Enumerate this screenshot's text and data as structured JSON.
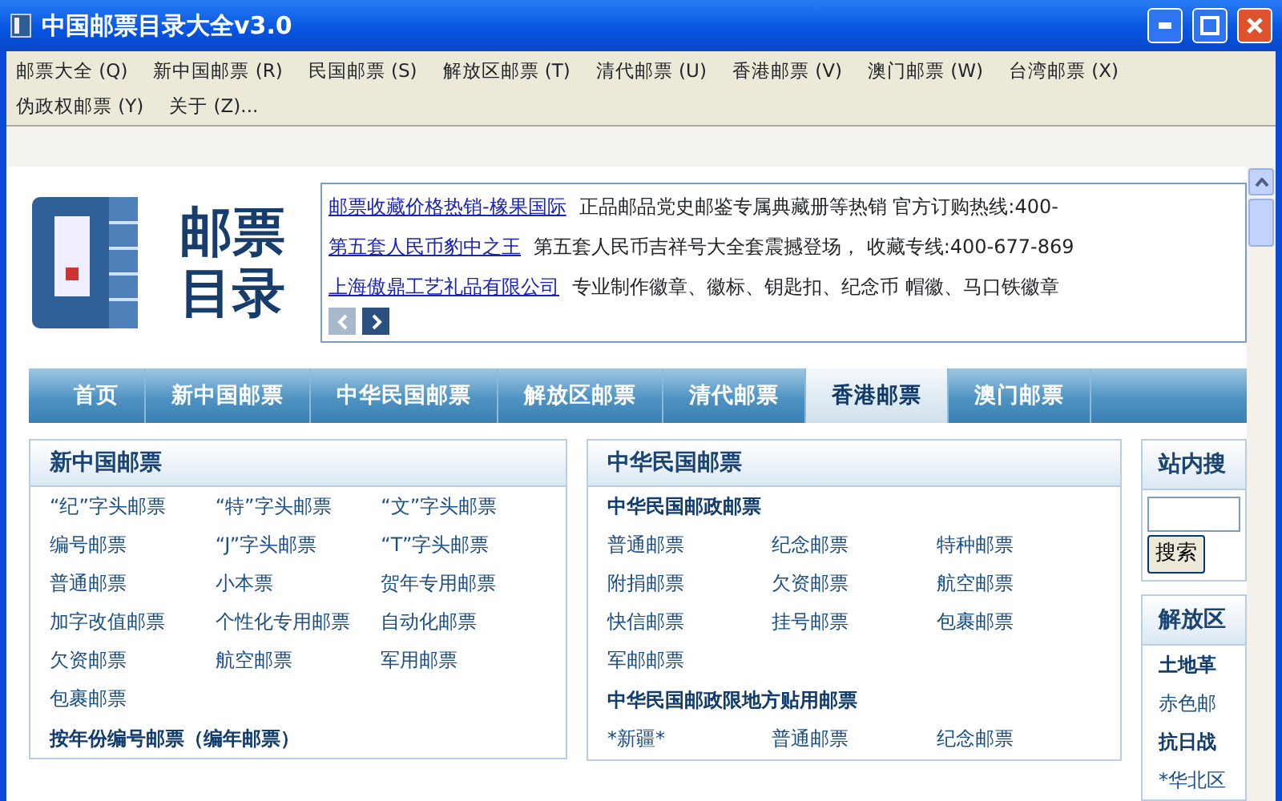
{
  "window": {
    "title": "中国邮票目录大全v3.0"
  },
  "menu": [
    "邮票大全 (Q)",
    "新中国邮票 (R)",
    "民国邮票 (S)",
    "解放区邮票 (T)",
    "清代邮票 (U)",
    "香港邮票 (V)",
    "澳门邮票 (W)",
    "台湾邮票 (X)",
    "伪政权邮票 (Y)",
    "关于 (Z)..."
  ],
  "logo": {
    "line_1": "邮票",
    "line_2": "目录"
  },
  "ads": [
    {
      "link": "邮票收藏价格热销-橡果国际",
      "text": "正品邮品党史邮鉴专属典藏册等热销  官方订购热线:400-"
    },
    {
      "link": "第五套人民币豹中之王",
      "text": "第五套人民币吉祥号大全套震撼登场，  收藏专线:400-677-869"
    },
    {
      "link": "上海傲鼎工艺礼品有限公司",
      "text": "专业制作徽章、徽标、钥匙扣、纪念币 帽徽、马口铁徽章"
    }
  ],
  "ad_pager": {
    "prev_disabled": true
  },
  "nav": [
    {
      "label": "首页",
      "selected": false
    },
    {
      "label": "新中国邮票",
      "selected": false
    },
    {
      "label": "中华民国邮票",
      "selected": false
    },
    {
      "label": "解放区邮票",
      "selected": false
    },
    {
      "label": "清代邮票",
      "selected": false
    },
    {
      "label": "香港邮票",
      "selected": true
    },
    {
      "label": "澳门邮票",
      "selected": false
    }
  ],
  "panel_new_china": {
    "title": "新中国邮票",
    "links": [
      "“纪”字头邮票",
      "“特”字头邮票",
      "“文”字头邮票",
      "编号邮票",
      "“J”字头邮票",
      "“T”字头邮票",
      "普通邮票",
      "小本票",
      "贺年专用邮票",
      "加字改值邮票",
      "个性化专用邮票",
      "自动化邮票",
      "欠资邮票",
      "航空邮票",
      "军用邮票",
      "包裹邮票"
    ],
    "subheading": "按年份编号邮票（编年邮票）"
  },
  "panel_roc": {
    "title": "中华民国邮票",
    "sections": [
      {
        "heading": "中华民国邮政邮票",
        "links": [
          "普通邮票",
          "纪念邮票",
          "特种邮票",
          "附捐邮票",
          "欠资邮票",
          "航空邮票",
          "快信邮票",
          "挂号邮票",
          "包裹邮票",
          "军邮邮票"
        ]
      },
      {
        "heading": "中华民国邮政限地方贴用邮票",
        "links": [
          "*新疆*",
          "普通邮票",
          "纪念邮票"
        ]
      }
    ]
  },
  "search_panel": {
    "title": "站内搜",
    "button": "搜索"
  },
  "liberated_panel": {
    "title": "解放区",
    "items": [
      {
        "kind": "heading",
        "text": "土地革"
      },
      {
        "kind": "link",
        "text": "赤色邮"
      },
      {
        "kind": "heading",
        "text": "抗日战"
      },
      {
        "kind": "link",
        "text": "*华北区"
      }
    ]
  }
}
